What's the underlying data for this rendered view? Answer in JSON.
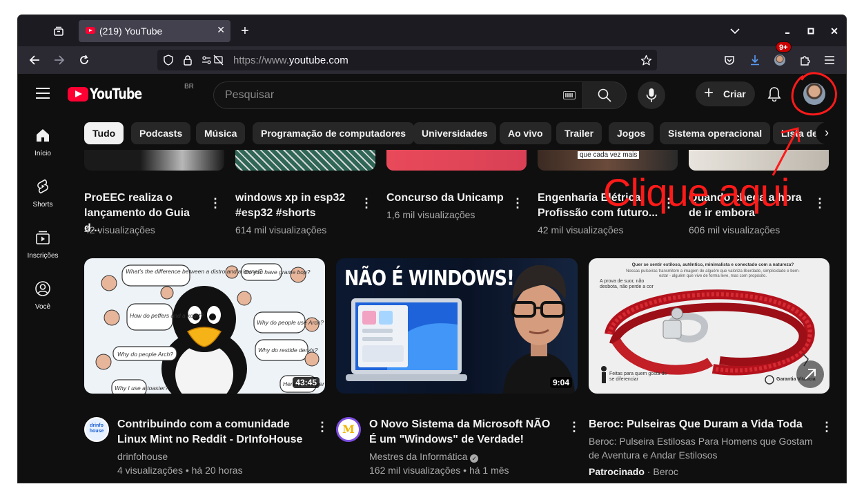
{
  "browser": {
    "tab_title": "(219) YouTube",
    "url_prefix": "https://www.",
    "url_domain": "youtube.com"
  },
  "header": {
    "logo_text": "YouTube",
    "country_code": "BR",
    "search_placeholder": "Pesquisar",
    "create_label": "Criar",
    "notification_badge": "9+"
  },
  "chips": [
    "Tudo",
    "Podcasts",
    "Música",
    "Programação de computadores",
    "Universidades",
    "Ao vivo",
    "Trailer",
    "Jogos",
    "Sistema operacional",
    "Lista de"
  ],
  "sidebar": [
    {
      "label": "Início",
      "icon": "home-icon"
    },
    {
      "label": "Shorts",
      "icon": "shorts-icon"
    },
    {
      "label": "Inscrições",
      "icon": "subscriptions-icon"
    },
    {
      "label": "Você",
      "icon": "you-icon"
    }
  ],
  "shorts": [
    {
      "title": "ProEEC realiza o lançamento do Guia d...",
      "views": "42 visualizações"
    },
    {
      "title": "windows xp in esp32 #esp32 #shorts",
      "views": "614 mil visualizações"
    },
    {
      "title": "Concurso da Unicamp",
      "views": "1,6 mil visualizações"
    },
    {
      "title": "Engenharia Elétrica: Profissão com futuro...",
      "views": "42 mil visualizações",
      "thumb_caption": "que cada vez mais"
    },
    {
      "title": "Quando chega a hora de ir embora",
      "views": "606 mil visualizações"
    }
  ],
  "videos": [
    {
      "title": "Contribuindo com a comunidade Linux Mint no Reddit - DrInfoHouse News...",
      "channel": "drinfohouse",
      "meta": "4 visualizações • há 20 horas",
      "duration": "43:45",
      "channel_avatar_text": "drinfo house",
      "thumb_bubbles": [
        "What's the difference between a distro and a kernel?",
        "Do you have grame bop?",
        "How do peffers and a kourt?",
        "Why do people use Arch?",
        "Why do restide dervis?",
        "Why do people Arch?",
        "Why I use a toaster?",
        "Here is h server"
      ]
    },
    {
      "title": "O Novo Sistema da Microsoft NÃO É um \"Windows\" de Verdade!",
      "channel": "Mestres da Informática",
      "meta": "162 mil visualizações • há 1 mês",
      "duration": "9:04",
      "thumb_text": "NÃO É WINDOWS!",
      "channel_avatar_text": "M"
    },
    {
      "title": "Beroc: Pulseiras Que Duram a Vida Toda",
      "description": "Beroc: Pulseira Estilosas Para Homens que Gostam de Aventura e Andar Estilosos",
      "sponsored_label": "Patrocinado",
      "advertiser": "Beroc",
      "thumb_heading": "Quer se sentir estiloso, autêntico, minimalista e conectado com a natureza?",
      "thumb_sub": "Nossas pulseiras transmitem a imagem de alguém que valoriza liberdade, simplicidade e bem-estar - alguém que vive de forma leve, mas com propósito.",
      "thumb_note1": "A prova de suor, não desbota, não perde a cor",
      "thumb_note2": "Feitas para quem gosta de se diferenciar",
      "thumb_note3": "Garantia Vitalícia"
    }
  ],
  "annotation": {
    "text": "Clique aqui",
    "color": "#ff1a1a"
  },
  "colors": {
    "background": "#0f0f0f",
    "youtube_red": "#ff0033",
    "chip_bg": "#272727"
  }
}
